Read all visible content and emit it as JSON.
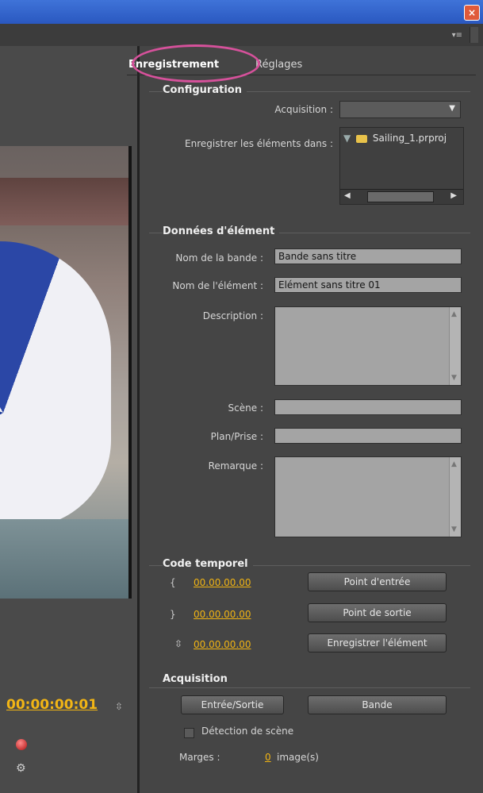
{
  "window": {
    "close_glyph": "×"
  },
  "panel": {
    "menu_glyph": "▾≡"
  },
  "tabs": [
    {
      "label": "Enregistrement"
    },
    {
      "label": "Réglages"
    }
  ],
  "configuration": {
    "title": "Configuration",
    "acquisition_label": "Acquisition :",
    "acquisition_value": "",
    "save_label": "Enregistrer les éléments dans :",
    "save_value": "Sailing_1.prproj"
  },
  "clip_data": {
    "title": "Données d'élément",
    "tape_label": "Nom de la bande :",
    "tape_value": "Bande sans titre",
    "clip_label": "Nom de l'élément :",
    "clip_value": "Elément sans titre 01",
    "description_label": "Description :",
    "scene_label": "Scène :",
    "shot_label": "Plan/Prise :",
    "comment_label": "Remarque :"
  },
  "timecode": {
    "title": "Code temporel",
    "in_value": "00.00.00.00",
    "out_value": "00.00.00.00",
    "dur_value": "00.00.00.00",
    "in_button": "Point d'entrée",
    "out_button": "Point de sortie",
    "log_button": "Enregistrer l'élément"
  },
  "capture": {
    "title": "Acquisition",
    "inout_button": "Entrée/Sortie",
    "tape_button": "Bande",
    "scene_detect_label": "Détection de scène",
    "margins_label": "Marges :",
    "margins_value": "0",
    "margins_unit": "image(s)"
  },
  "monitor": {
    "timecode": "00:00:00:01"
  },
  "colors": {
    "accent_timecode": "#f1b413",
    "highlight": "#d6519b"
  }
}
